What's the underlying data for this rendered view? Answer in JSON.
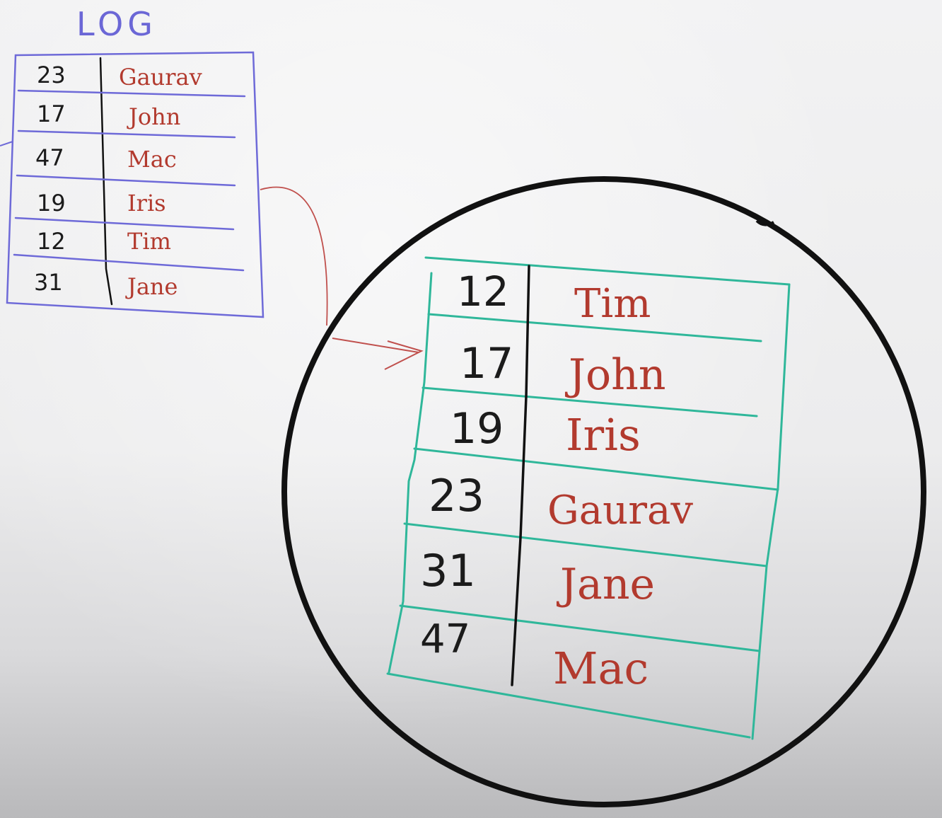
{
  "log": {
    "title": "LOG",
    "rows": [
      {
        "key": "23",
        "name": "Gaurav"
      },
      {
        "key": "17",
        "name": "John"
      },
      {
        "key": "47",
        "name": "Mac"
      },
      {
        "key": "19",
        "name": "Iris"
      },
      {
        "key": "12",
        "name": "Tim"
      },
      {
        "key": "31",
        "name": "Jane"
      }
    ]
  },
  "sorted": {
    "rows": [
      {
        "key": "12",
        "name": "Tim"
      },
      {
        "key": "17",
        "name": "John"
      },
      {
        "key": "19",
        "name": "Iris"
      },
      {
        "key": "23",
        "name": "Gaurav"
      },
      {
        "key": "31",
        "name": "Jane"
      },
      {
        "key": "47",
        "name": "Mac"
      }
    ]
  },
  "colors": {
    "log_lines": "#6e6ad8",
    "sorted_lines": "#2fb79a",
    "names": "#b23a2e",
    "numbers": "#1b1b1b",
    "circle": "#111111",
    "connector": "#c0504d"
  }
}
